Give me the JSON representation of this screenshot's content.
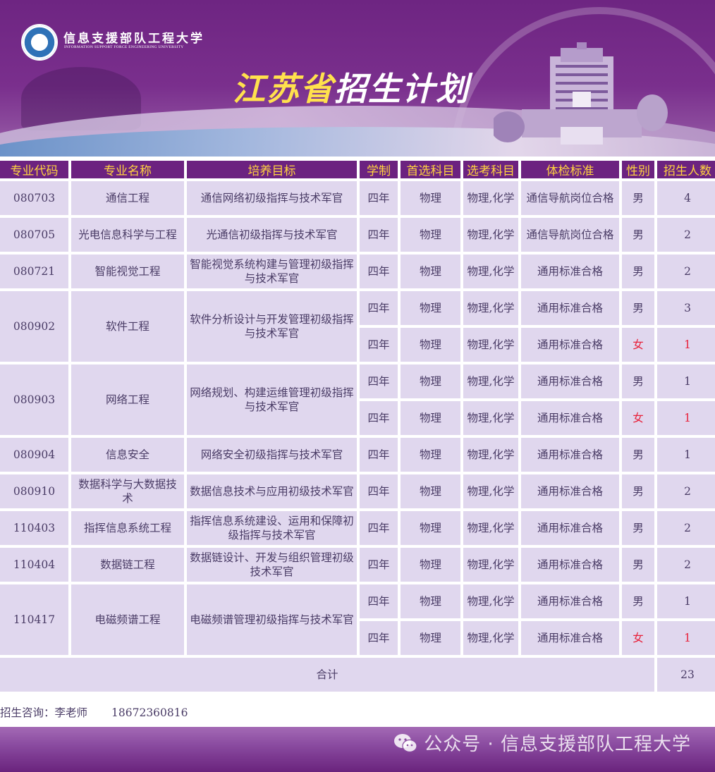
{
  "header": {
    "university_name": "信息支援部队工程大学",
    "university_name_en": "INFORMATION SUPPORT FORCE ENGINEERING UNIVERSITY",
    "title_province": "江苏省",
    "title_rest": "招生计划"
  },
  "table": {
    "headers": [
      "专业代码",
      "专业名称",
      "培养目标",
      "学制",
      "首选科目",
      "选考科目",
      "体检标准",
      "性别",
      "招生人数"
    ],
    "rows": [
      {
        "code": "080703",
        "name": "通信工程",
        "goal": "通信网络初级指挥与技术军官",
        "sub": [
          {
            "years": "四年",
            "first": "物理",
            "elective": "物理,化学",
            "health": "通信导航岗位合格",
            "gender": "男",
            "count": "4"
          }
        ]
      },
      {
        "code": "080705",
        "name": "光电信息科学与工程",
        "goal": "光通信初级指挥与技术军官",
        "sub": [
          {
            "years": "四年",
            "first": "物理",
            "elective": "物理,化学",
            "health": "通信导航岗位合格",
            "gender": "男",
            "count": "2"
          }
        ]
      },
      {
        "code": "080721",
        "name": "智能视觉工程",
        "goal": "智能视觉系统构建与管理初级指挥与技术军官",
        "sub": [
          {
            "years": "四年",
            "first": "物理",
            "elective": "物理,化学",
            "health": "通用标准合格",
            "gender": "男",
            "count": "2"
          }
        ]
      },
      {
        "code": "080902",
        "name": "软件工程",
        "goal": "软件分析设计与开发管理初级指挥与技术军官",
        "sub": [
          {
            "years": "四年",
            "first": "物理",
            "elective": "物理,化学",
            "health": "通用标准合格",
            "gender": "男",
            "count": "3"
          },
          {
            "years": "四年",
            "first": "物理",
            "elective": "物理,化学",
            "health": "通用标准合格",
            "gender": "女",
            "count": "1"
          }
        ]
      },
      {
        "code": "080903",
        "name": "网络工程",
        "goal": "网络规划、构建运维管理初级指挥与技术军官",
        "sub": [
          {
            "years": "四年",
            "first": "物理",
            "elective": "物理,化学",
            "health": "通用标准合格",
            "gender": "男",
            "count": "1"
          },
          {
            "years": "四年",
            "first": "物理",
            "elective": "物理,化学",
            "health": "通用标准合格",
            "gender": "女",
            "count": "1"
          }
        ]
      },
      {
        "code": "080904",
        "name": "信息安全",
        "goal": "网络安全初级指挥与技术军官",
        "sub": [
          {
            "years": "四年",
            "first": "物理",
            "elective": "物理,化学",
            "health": "通用标准合格",
            "gender": "男",
            "count": "1"
          }
        ]
      },
      {
        "code": "080910",
        "name": "数据科学与大数据技术",
        "goal": "数据信息技术与应用初级技术军官",
        "sub": [
          {
            "years": "四年",
            "first": "物理",
            "elective": "物理,化学",
            "health": "通用标准合格",
            "gender": "男",
            "count": "2"
          }
        ]
      },
      {
        "code": "110403",
        "name": "指挥信息系统工程",
        "goal": "指挥信息系统建设、运用和保障初级指挥与技术军官",
        "sub": [
          {
            "years": "四年",
            "first": "物理",
            "elective": "物理,化学",
            "health": "通用标准合格",
            "gender": "男",
            "count": "2"
          }
        ]
      },
      {
        "code": "110404",
        "name": "数据链工程",
        "goal": "数据链设计、开发与组织管理初级技术军官",
        "sub": [
          {
            "years": "四年",
            "first": "物理",
            "elective": "物理,化学",
            "health": "通用标准合格",
            "gender": "男",
            "count": "2"
          }
        ]
      },
      {
        "code": "110417",
        "name": "电磁频谱工程",
        "goal": "电磁频谱管理初级指挥与技术军官",
        "sub": [
          {
            "years": "四年",
            "first": "物理",
            "elective": "物理,化学",
            "health": "通用标准合格",
            "gender": "男",
            "count": "1"
          },
          {
            "years": "四年",
            "first": "物理",
            "elective": "物理,化学",
            "health": "通用标准合格",
            "gender": "女",
            "count": "1"
          }
        ]
      }
    ],
    "total_label": "合计",
    "total_value": "23"
  },
  "contact": {
    "label": "招生咨询：李老师",
    "phone": "18672360816"
  },
  "footer": {
    "watermark": "公众号 · 信息支援部队工程大学"
  },
  "colors": {
    "header_bg": "#6c2280",
    "header_text": "#ffd23f",
    "cell_bg": "#e0d7ee",
    "female_red": "#e8213a",
    "title_yellow": "#ffe14d"
  }
}
